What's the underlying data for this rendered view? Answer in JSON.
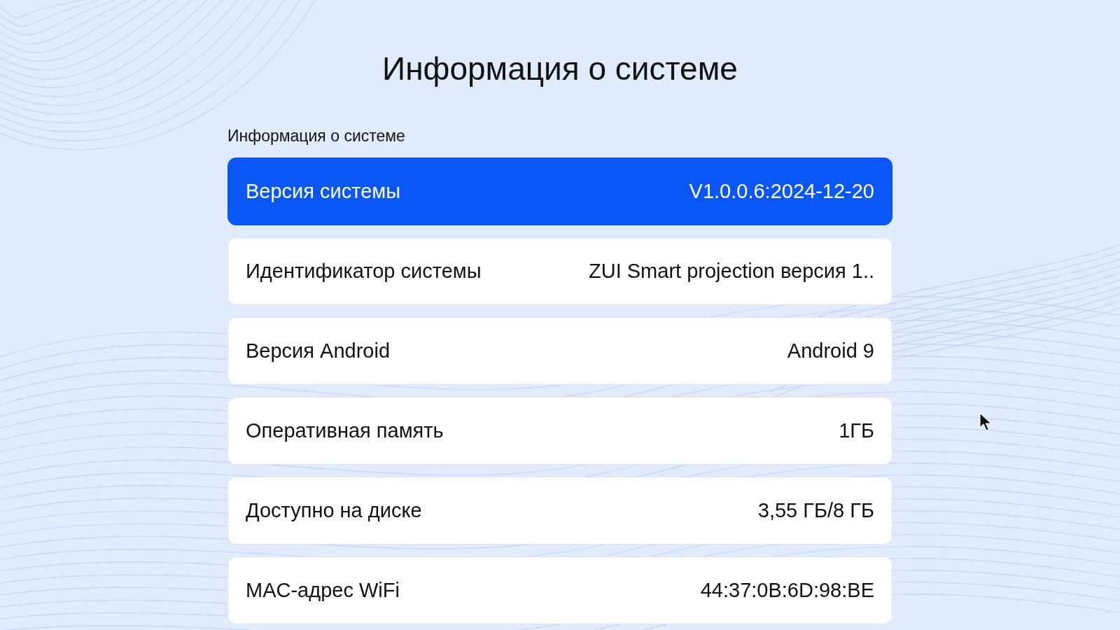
{
  "title": "Информация о системе",
  "section": {
    "label": "Информация о системе",
    "items": [
      {
        "label": "Версия системы",
        "value": "V1.0.0.6:2024-12-20",
        "selected": true
      },
      {
        "label": "Идентификатор системы",
        "value": "ZUI Smart projection версия 1..",
        "selected": false
      },
      {
        "label": "Версия Android",
        "value": "Android 9",
        "selected": false
      },
      {
        "label": "Оперативная память",
        "value": "1ГБ",
        "selected": false
      },
      {
        "label": "Доступно на диске",
        "value": "3,55 ГБ/8 ГБ",
        "selected": false
      },
      {
        "label": "MAC-адрес WiFi",
        "value": "44:37:0B:6D:98:BE",
        "selected": false
      }
    ]
  }
}
